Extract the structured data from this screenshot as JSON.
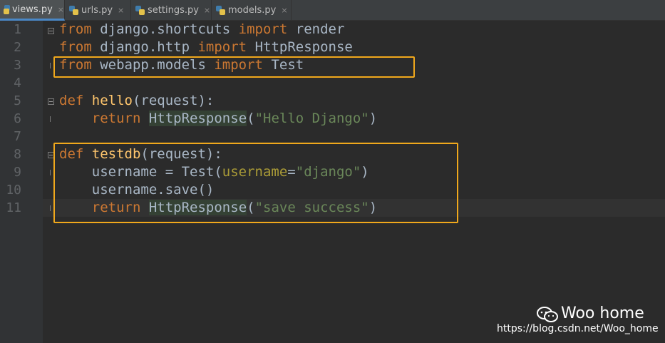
{
  "tabs": [
    {
      "label": "views.py",
      "icon": "python-file-icon",
      "close": "×",
      "active": true
    },
    {
      "label": "urls.py",
      "icon": "python-file-icon",
      "close": "×",
      "active": false
    },
    {
      "label": "settings.py",
      "icon": "python-file-icon",
      "close": "×",
      "active": false
    },
    {
      "label": "models.py",
      "icon": "python-file-icon",
      "close": "×",
      "active": false
    }
  ],
  "line_numbers": [
    "1",
    "2",
    "3",
    "4",
    "5",
    "6",
    "7",
    "8",
    "9",
    "10",
    "11"
  ],
  "code": {
    "l1": {
      "kw1": "from",
      "mod": " django.shortcuts ",
      "kw2": "import",
      "name": " render"
    },
    "l2": {
      "kw1": "from",
      "mod": " django.http ",
      "kw2": "import",
      "name": " HttpResponse"
    },
    "l3": {
      "kw1": "from",
      "mod": " webapp.models ",
      "kw2": "import",
      "name": " Test"
    },
    "l5": {
      "kw": "def",
      "sp": " ",
      "fn": "hello",
      "args": "(request):"
    },
    "l6": {
      "indent": "    ",
      "kw": "return",
      "sp": " ",
      "cls": "HttpResponse",
      "open": "(",
      "str": "\"Hello Django\"",
      "close": ")"
    },
    "l8": {
      "kw": "def",
      "sp": " ",
      "fn": "testdb",
      "args": "(request):"
    },
    "l9": {
      "pre": "    username = Test(",
      "kwarg": "username",
      "eq": "=",
      "str": "\"django\"",
      "close": ")"
    },
    "l10": {
      "text": "    username.save()"
    },
    "l11": {
      "indent": "    ",
      "kw": "return",
      "sp": " ",
      "cls": "HttpResponse",
      "open": "(",
      "str": "\"save success\"",
      "close": ")"
    }
  },
  "watermark": {
    "title": "Woo home",
    "url": "https://blog.csdn.net/Woo_home",
    "logo": "wechat-logo"
  },
  "colors": {
    "background": "#2b2b2b",
    "keyword": "#cc7832",
    "function": "#ffc66d",
    "string": "#6a8759",
    "highlight_box": "#f0a81c"
  }
}
